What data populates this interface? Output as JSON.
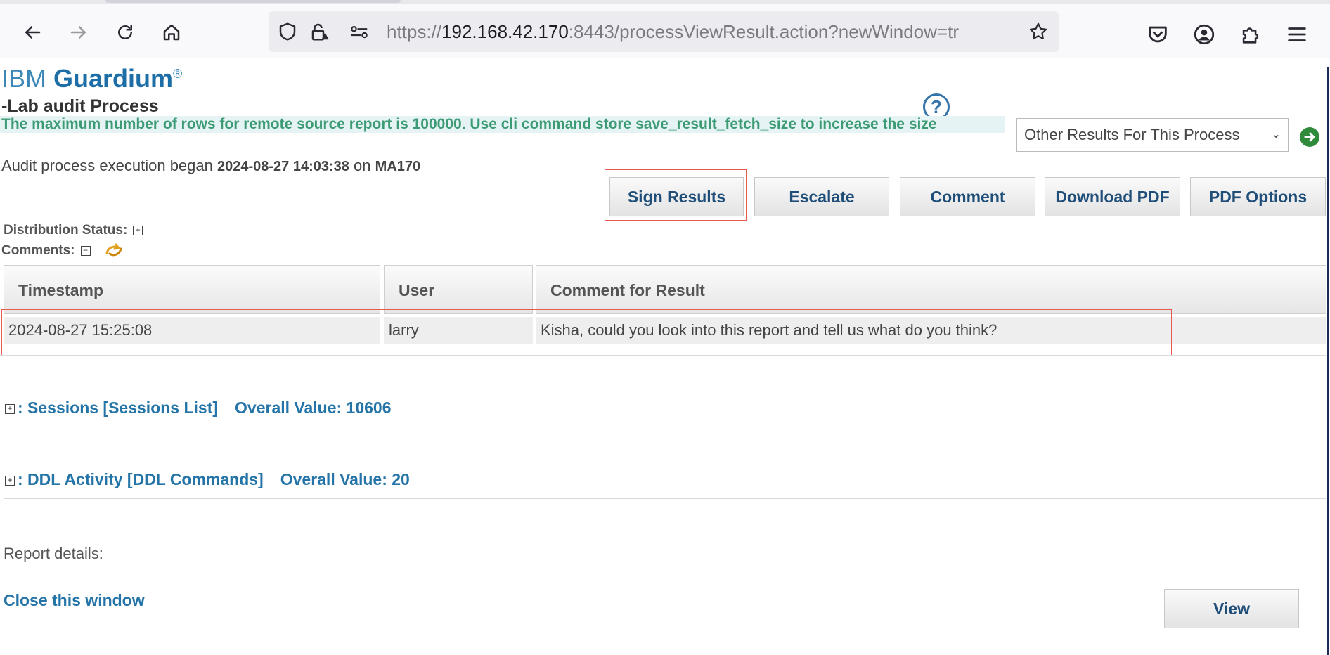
{
  "browser": {
    "url_prefix": "https://",
    "url_host": "192.168.42.170",
    "url_rest": ":8443/processViewResult.action?newWindow=tr"
  },
  "logo": {
    "prefix": "IBM ",
    "brand": "Guardium",
    "mark": "®"
  },
  "process_title": "-Lab audit Process",
  "notice": "The maximum number of rows for remote source report is  100000. Use cli command store save_result_fetch_size to increase the size",
  "results_select": {
    "selected": "Other Results For This Process"
  },
  "execution": {
    "label": "Audit process execution began",
    "timestamp": "2024-08-27 14:03:38",
    "on_label": "on",
    "host": "MA170"
  },
  "actions": {
    "sign": "Sign Results",
    "escalate": "Escalate",
    "comment": "Comment",
    "download_pdf": "Download PDF",
    "pdf_options": "PDF Options"
  },
  "distribution_status_label": "Distribution Status:",
  "comments_label": "Comments:",
  "comments_table": {
    "headers": [
      "Timestamp",
      "User",
      "Comment for Result"
    ],
    "rows": [
      [
        "2024-08-27 15:25:08",
        "larry",
        "Kisha, could you look into this report and tell us what do you think?"
      ]
    ]
  },
  "sections": [
    {
      "name": ": Sessions [Sessions List]",
      "value": "Overall Value: 10606"
    },
    {
      "name": ": DDL Activity [DDL Commands]",
      "value": "Overall Value: 20"
    }
  ],
  "report_details_label": "Report details:",
  "close_link": "Close this window",
  "view_button": "View",
  "icons": {
    "back": "arrow-left-icon",
    "forward": "arrow-right-icon",
    "reload": "reload-icon",
    "home": "home-icon",
    "shield": "shield-icon",
    "lock": "lock-warning-icon",
    "permissions": "permissions-icon",
    "bookmark": "star-icon",
    "pocket": "pocket-icon",
    "account": "account-icon",
    "extensions": "extensions-icon",
    "menu": "hamburger-menu-icon",
    "help": "help-icon",
    "go": "go-arrow-icon",
    "refresh": "refresh-comments-icon"
  },
  "colors": {
    "brand": "#1d6ea6",
    "notice_text": "#3c9b74",
    "highlight": "#e35a4f",
    "link": "#2474a8"
  }
}
